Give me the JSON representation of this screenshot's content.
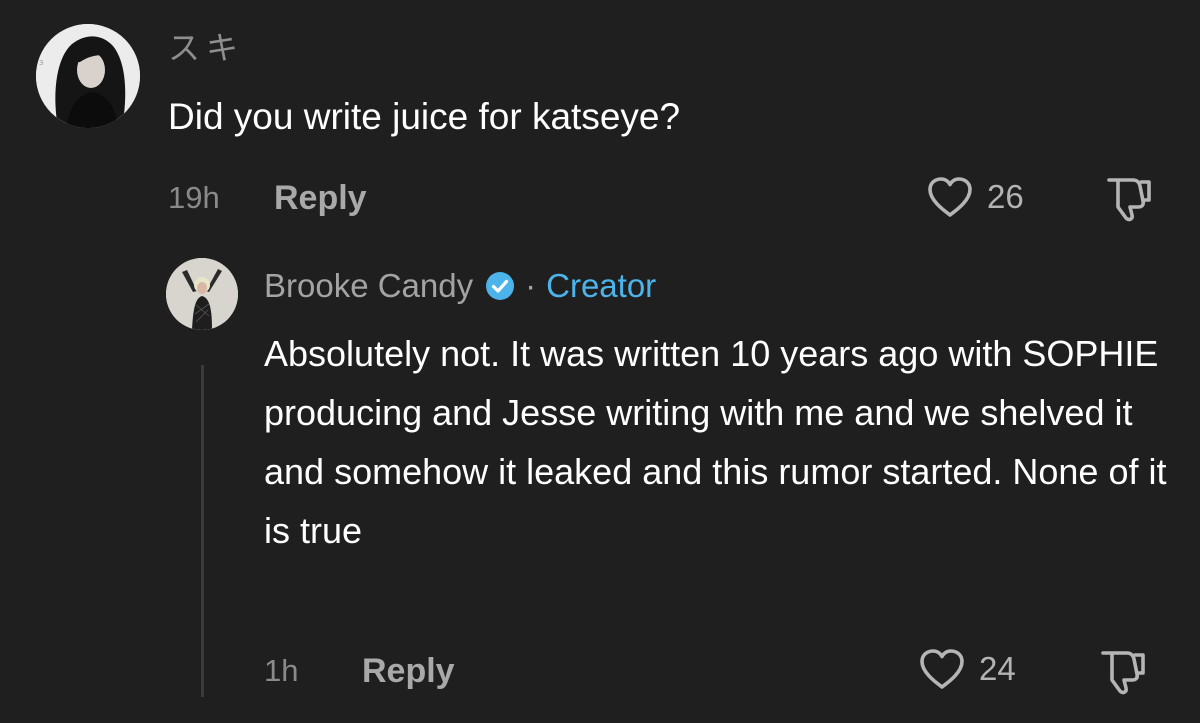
{
  "comment": {
    "username": "スキ",
    "text": "Did you write juice for katseye?",
    "time": "19h",
    "reply_label": "Reply",
    "likes": "26",
    "avatar_icon": "user-avatar-dark-hair",
    "like_icon": "heart-outline-icon",
    "dislike_icon": "thumbs-down-icon"
  },
  "reply": {
    "username": "Brooke Candy",
    "separator": "·",
    "creator_label": "Creator",
    "verified_color": "#4cb4ea",
    "text": "Absolutely not. It was written 10 years ago with SOPHIE producing and Jesse writing with me and we shelved it and somehow it leaked and this rumor started. None of it is true",
    "time": "1h",
    "reply_label": "Reply",
    "likes": "24",
    "avatar_icon": "user-avatar-dancer",
    "like_icon": "heart-outline-icon",
    "dislike_icon": "thumbs-down-icon"
  },
  "colors": {
    "background": "#1f1f1f",
    "primary_text": "#ffffff",
    "secondary_text": "#8e8e8e",
    "accent": "#4cb4ea"
  }
}
